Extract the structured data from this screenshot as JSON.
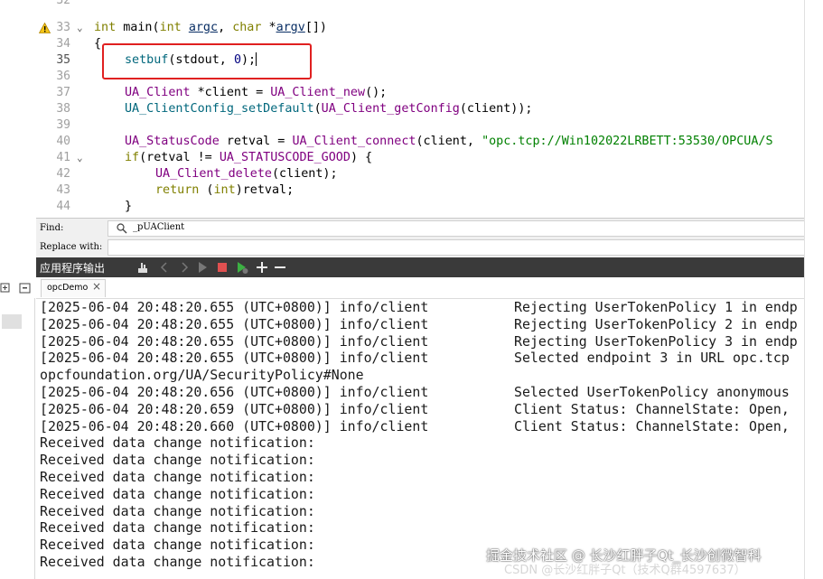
{
  "editor": {
    "gutter": [
      {
        "n": "32"
      },
      {
        "n": "33"
      },
      {
        "n": "34"
      },
      {
        "n": "35"
      },
      {
        "n": "36"
      },
      {
        "n": "37"
      },
      {
        "n": "38"
      },
      {
        "n": "39"
      },
      {
        "n": "40"
      },
      {
        "n": "41"
      },
      {
        "n": "42"
      },
      {
        "n": "43"
      },
      {
        "n": "44"
      }
    ],
    "code": {
      "l33_a": "int",
      "l33_b": " main(",
      "l33_c": "int",
      "l33_d": " ",
      "l33_e": "argc",
      "l33_f": ", ",
      "l33_g": "char",
      "l33_h": " *",
      "l33_i": "argv",
      "l33_j": "[])",
      "l34": "{",
      "l35_a": "setbuf",
      "l35_b": "(stdout, ",
      "l35_c": "0",
      "l35_d": ");",
      "l37_a": "UA_Client",
      "l37_b": " *client = ",
      "l37_c": "UA_Client_new",
      "l37_d": "();",
      "l38_a": "UA_ClientConfig_setDefault",
      "l38_b": "(",
      "l38_c": "UA_Client_getConfig",
      "l38_d": "(client));",
      "l40_a": "UA_StatusCode",
      "l40_b": " retval = ",
      "l40_c": "UA_Client_connect",
      "l40_d": "(client, ",
      "l40_e": "\"opc.tcp://Win102022LRBETT:53530/OPCUA/S",
      "l41_a": "if",
      "l41_b": "(retval != ",
      "l41_c": "UA_STATUSCODE_GOOD",
      "l41_d": ") {",
      "l42_a": "UA_Client_delete",
      "l42_b": "(client);",
      "l43_a": "return",
      "l43_b": " (",
      "l43_c": "int",
      "l43_d": ")retval;",
      "l44": "}"
    }
  },
  "find": {
    "label": "Find:",
    "value": "_pUAClient",
    "replace_label": "Replace with:"
  },
  "output": {
    "title": "应用程序输出",
    "tab": "opcDemo",
    "log": [
      "[2025-06-04 20:48:20.655 (UTC+0800)] info/client",
      "[2025-06-04 20:48:20.655 (UTC+0800)] info/client",
      "[2025-06-04 20:48:20.655 (UTC+0800)] info/client",
      "[2025-06-04 20:48:20.655 (UTC+0800)] info/client",
      "opcfoundation.org/UA/SecurityPolicy#None",
      "[2025-06-04 20:48:20.656 (UTC+0800)] info/client",
      "[2025-06-04 20:48:20.659 (UTC+0800)] info/client",
      "[2025-06-04 20:48:20.660 (UTC+0800)] info/client",
      "Received data change notification:",
      "Received data change notification:",
      "Received data change notification:",
      "Received data change notification:",
      "Received data change notification:",
      "Received data change notification:",
      "Received data change notification:",
      "Received data change notification:"
    ],
    "log_msgs": [
      "Rejecting UserTokenPolicy 1 in endp",
      "Rejecting UserTokenPolicy 2 in endp",
      "Rejecting UserTokenPolicy 3 in endp",
      "Selected endpoint 3 in URL opc.tcp",
      "",
      "Selected UserTokenPolicy anonymous",
      "Client Status: ChannelState: Open,",
      "Client Status: ChannelState: Open,"
    ]
  },
  "watermark": {
    "line1": "掘金技术社区 @ 长沙红胖子Qt_长沙创微智科",
    "line2": "CSDN @长沙红胖子Qt（技术Q群4597637）"
  },
  "colors": {
    "toolbar_bg": "#3a3a3a",
    "highlight": "#e02020",
    "string": "#008000",
    "keyword": "#808000",
    "type": "#800080"
  }
}
